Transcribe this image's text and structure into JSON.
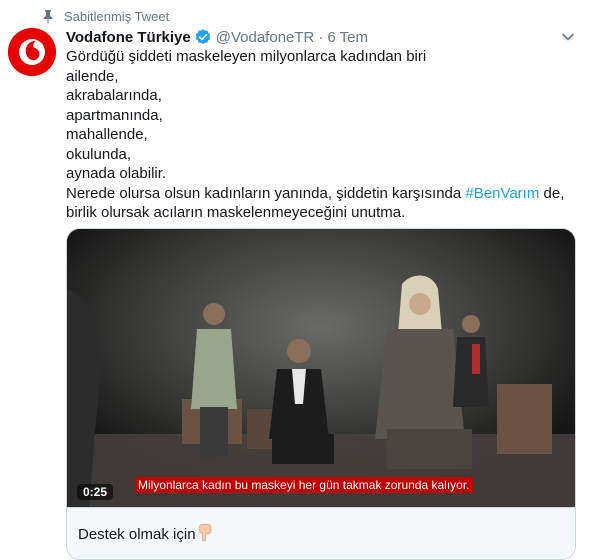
{
  "pinned": {
    "label": "Sabitlenmiş Tweet",
    "icon": "pin-icon"
  },
  "author": {
    "name": "Vodafone Türkiye",
    "handle": "@VodafoneTR",
    "separator": "·",
    "time": "6 Tem",
    "verified": true,
    "avatar_icon": "vodafone-logo-icon"
  },
  "tweet": {
    "lines": [
      "Gördüğü şiddeti maskeleyen milyonlarca kadından biri",
      "ailende,",
      "akrabalarında,",
      "apartmanında,",
      "mahallende,",
      "okulunda,",
      "aynada olabilir."
    ],
    "line8_before": "Nerede olursa olsun kadınların yanında, şiddetin karşısında ",
    "hashtag": "#BenVarım",
    "line8_after": " de,",
    "line9": "birlik olursak acıların maskelenmeyeceğini unutma."
  },
  "media": {
    "duration": "0:25",
    "subtitle": "Milyonlarca kadın bu maskeyi her gün takmak zorunda kalıyor.",
    "caption": "Destek olmak için",
    "caption_emoji_icon": "pointing-down-hand-icon"
  },
  "colors": {
    "brand": "#e60000",
    "link": "#1da1f2",
    "secondary_text": "#657786",
    "subtitle_bg": "#c00000"
  }
}
